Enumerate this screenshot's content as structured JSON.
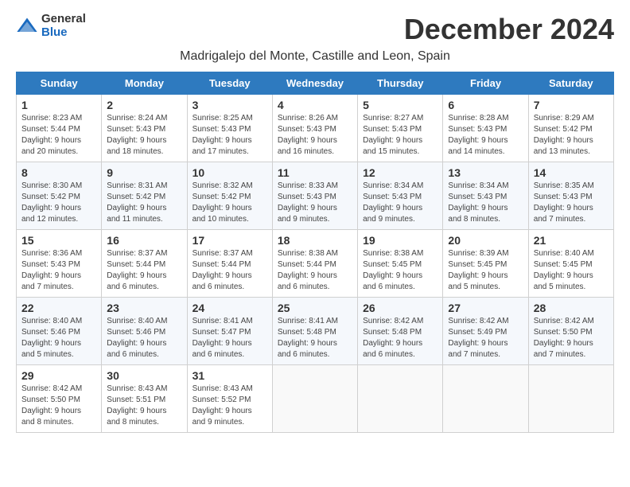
{
  "logo": {
    "general": "General",
    "blue": "Blue"
  },
  "title": "December 2024",
  "subtitle": "Madrigalejo del Monte, Castille and Leon, Spain",
  "weekdays": [
    "Sunday",
    "Monday",
    "Tuesday",
    "Wednesday",
    "Thursday",
    "Friday",
    "Saturday"
  ],
  "weeks": [
    [
      {
        "day": 1,
        "sunrise": "8:23 AM",
        "sunset": "5:44 PM",
        "daylight": "9 hours and 20 minutes."
      },
      {
        "day": 2,
        "sunrise": "8:24 AM",
        "sunset": "5:43 PM",
        "daylight": "9 hours and 18 minutes."
      },
      {
        "day": 3,
        "sunrise": "8:25 AM",
        "sunset": "5:43 PM",
        "daylight": "9 hours and 17 minutes."
      },
      {
        "day": 4,
        "sunrise": "8:26 AM",
        "sunset": "5:43 PM",
        "daylight": "9 hours and 16 minutes."
      },
      {
        "day": 5,
        "sunrise": "8:27 AM",
        "sunset": "5:43 PM",
        "daylight": "9 hours and 15 minutes."
      },
      {
        "day": 6,
        "sunrise": "8:28 AM",
        "sunset": "5:43 PM",
        "daylight": "9 hours and 14 minutes."
      },
      {
        "day": 7,
        "sunrise": "8:29 AM",
        "sunset": "5:42 PM",
        "daylight": "9 hours and 13 minutes."
      }
    ],
    [
      {
        "day": 8,
        "sunrise": "8:30 AM",
        "sunset": "5:42 PM",
        "daylight": "9 hours and 12 minutes."
      },
      {
        "day": 9,
        "sunrise": "8:31 AM",
        "sunset": "5:42 PM",
        "daylight": "9 hours and 11 minutes."
      },
      {
        "day": 10,
        "sunrise": "8:32 AM",
        "sunset": "5:42 PM",
        "daylight": "9 hours and 10 minutes."
      },
      {
        "day": 11,
        "sunrise": "8:33 AM",
        "sunset": "5:43 PM",
        "daylight": "9 hours and 9 minutes."
      },
      {
        "day": 12,
        "sunrise": "8:34 AM",
        "sunset": "5:43 PM",
        "daylight": "9 hours and 9 minutes."
      },
      {
        "day": 13,
        "sunrise": "8:34 AM",
        "sunset": "5:43 PM",
        "daylight": "9 hours and 8 minutes."
      },
      {
        "day": 14,
        "sunrise": "8:35 AM",
        "sunset": "5:43 PM",
        "daylight": "9 hours and 7 minutes."
      }
    ],
    [
      {
        "day": 15,
        "sunrise": "8:36 AM",
        "sunset": "5:43 PM",
        "daylight": "9 hours and 7 minutes."
      },
      {
        "day": 16,
        "sunrise": "8:37 AM",
        "sunset": "5:44 PM",
        "daylight": "9 hours and 6 minutes."
      },
      {
        "day": 17,
        "sunrise": "8:37 AM",
        "sunset": "5:44 PM",
        "daylight": "9 hours and 6 minutes."
      },
      {
        "day": 18,
        "sunrise": "8:38 AM",
        "sunset": "5:44 PM",
        "daylight": "9 hours and 6 minutes."
      },
      {
        "day": 19,
        "sunrise": "8:38 AM",
        "sunset": "5:45 PM",
        "daylight": "9 hours and 6 minutes."
      },
      {
        "day": 20,
        "sunrise": "8:39 AM",
        "sunset": "5:45 PM",
        "daylight": "9 hours and 5 minutes."
      },
      {
        "day": 21,
        "sunrise": "8:40 AM",
        "sunset": "5:45 PM",
        "daylight": "9 hours and 5 minutes."
      }
    ],
    [
      {
        "day": 22,
        "sunrise": "8:40 AM",
        "sunset": "5:46 PM",
        "daylight": "9 hours and 5 minutes."
      },
      {
        "day": 23,
        "sunrise": "8:40 AM",
        "sunset": "5:46 PM",
        "daylight": "9 hours and 6 minutes."
      },
      {
        "day": 24,
        "sunrise": "8:41 AM",
        "sunset": "5:47 PM",
        "daylight": "9 hours and 6 minutes."
      },
      {
        "day": 25,
        "sunrise": "8:41 AM",
        "sunset": "5:48 PM",
        "daylight": "9 hours and 6 minutes."
      },
      {
        "day": 26,
        "sunrise": "8:42 AM",
        "sunset": "5:48 PM",
        "daylight": "9 hours and 6 minutes."
      },
      {
        "day": 27,
        "sunrise": "8:42 AM",
        "sunset": "5:49 PM",
        "daylight": "9 hours and 7 minutes."
      },
      {
        "day": 28,
        "sunrise": "8:42 AM",
        "sunset": "5:50 PM",
        "daylight": "9 hours and 7 minutes."
      }
    ],
    [
      {
        "day": 29,
        "sunrise": "8:42 AM",
        "sunset": "5:50 PM",
        "daylight": "9 hours and 8 minutes."
      },
      {
        "day": 30,
        "sunrise": "8:43 AM",
        "sunset": "5:51 PM",
        "daylight": "9 hours and 8 minutes."
      },
      {
        "day": 31,
        "sunrise": "8:43 AM",
        "sunset": "5:52 PM",
        "daylight": "9 hours and 9 minutes."
      },
      null,
      null,
      null,
      null
    ]
  ]
}
